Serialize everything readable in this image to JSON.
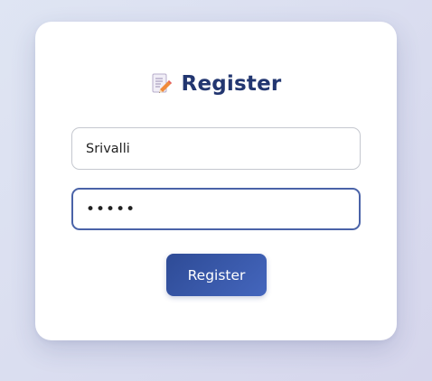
{
  "form": {
    "title": "Register",
    "title_icon": "memo-pencil-icon",
    "username_value": "Srivalli",
    "password_masked": "•••••",
    "submit_label": "Register"
  },
  "colors": {
    "title": "#223670",
    "button_start": "#2e4b96",
    "button_end": "#4466bd",
    "focus_border": "#4a63a8"
  }
}
